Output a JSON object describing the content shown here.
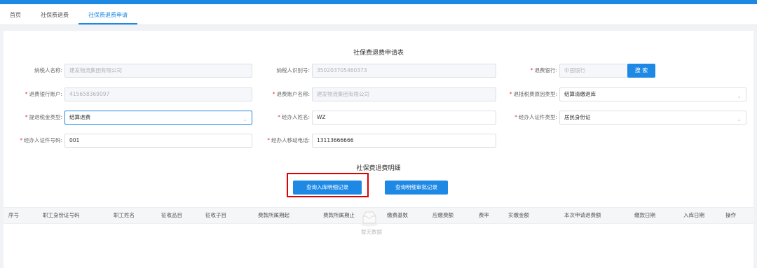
{
  "tabs": [
    {
      "label": "首页"
    },
    {
      "label": "社保费退费"
    },
    {
      "label": "社保费退费申请"
    }
  ],
  "form": {
    "title": "社保费退费申请表",
    "taxpayer_name": {
      "label": "纳税人名称:",
      "value": "建发物流集团有限公司"
    },
    "taxpayer_id": {
      "label": "纳税人识别号:",
      "value": "350203705460373"
    },
    "refund_bank": {
      "label": "退费银行:",
      "value": "中国银行"
    },
    "search_label": "搜 索",
    "refund_bank_account": {
      "label": "退费银行账户:",
      "value": "415658369097"
    },
    "refund_account_name": {
      "label": "退费账户名称:",
      "value": "建发物流集团有限公司"
    },
    "refund_reason_type": {
      "label": "退抵税费原因类型:",
      "value": "结算清缴退库"
    },
    "refund_tax_type": {
      "label": "提退税金类型:",
      "value": "结算退费"
    },
    "handler_name": {
      "label": "经办人姓名:",
      "value": "WZ"
    },
    "handler_id_type": {
      "label": "经办人证件类型:",
      "value": "居民身份证"
    },
    "handler_id_number": {
      "label": "经办人证件号码:",
      "value": "001"
    },
    "handler_phone": {
      "label": "经办人移动电话:",
      "value": "13113666666"
    }
  },
  "detail": {
    "title": "社保费退费明细",
    "query_warehouse_label": "查询入库明细记录",
    "query_approval_label": "查询明细审批记录"
  },
  "table": {
    "headers": [
      "序号",
      "职工身份证号码",
      "职工姓名",
      "征收品目",
      "征收子目",
      "费款所属期起",
      "费款所属期止",
      "缴费基数",
      "应缴费额",
      "费率",
      "实缴金额",
      "本次申请退费额",
      "缴款日期",
      "入库日期",
      "操作"
    ],
    "empty_text": "暂无数据"
  },
  "colors": {
    "accent": "#1e88e5",
    "highlight": "#e00000",
    "required": "#e53935"
  }
}
